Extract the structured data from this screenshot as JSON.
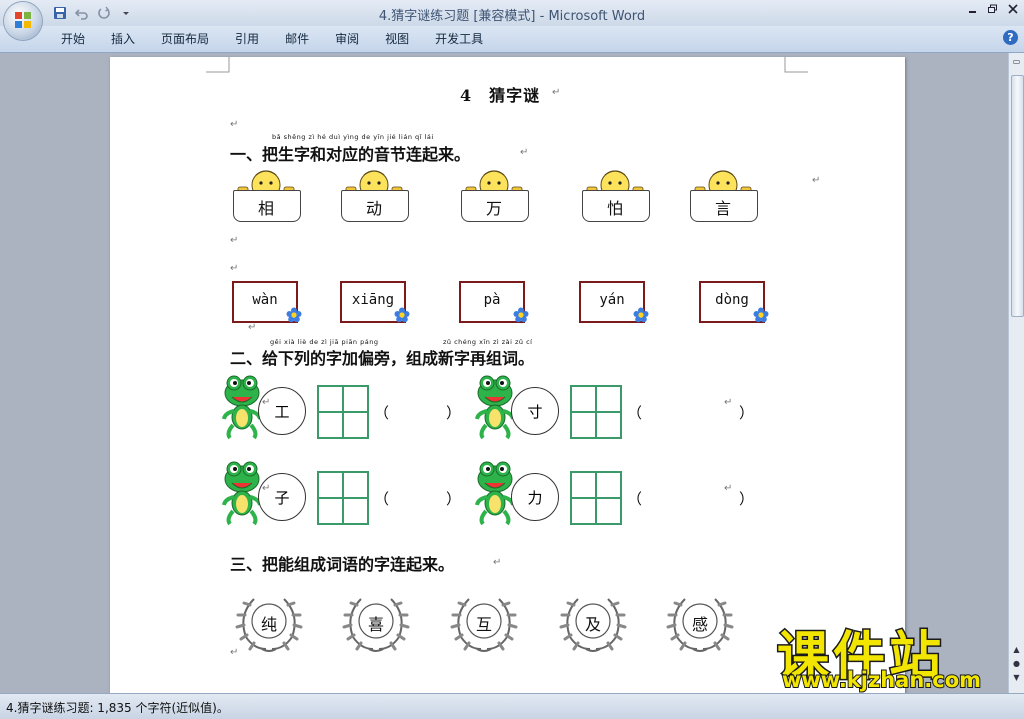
{
  "window": {
    "title": "4.猜字谜练习题 [兼容模式] - Microsoft Word",
    "controls": [
      "minimize-icon",
      "restore-icon",
      "close-icon"
    ]
  },
  "quick_access": [
    "save-icon",
    "undo-icon",
    "redo-icon",
    "customize-icon"
  ],
  "ribbon": {
    "tabs": [
      "开始",
      "插入",
      "页面布局",
      "引用",
      "邮件",
      "审阅",
      "视图",
      "开发工具"
    ],
    "help": "?"
  },
  "document": {
    "title": "4　猜字谜",
    "section1": {
      "pinyin": "bǎ shēng zì hé duì yìng de yīn jié lián qǐ lái",
      "heading": "一、把生字和对应的音节连起来。",
      "characters": [
        "相",
        "动",
        "万",
        "怕",
        "言"
      ],
      "syllables": [
        "wàn",
        "xiāng",
        "pà",
        "yán",
        "dòng"
      ]
    },
    "section2": {
      "pinyin_a": "gěi xià liè de zì jiā piān páng",
      "pinyin_b": "zǔ chéng xīn zì zài zǔ cí",
      "heading": "二、给下列的字加偏旁，组成新字再组词。",
      "characters": [
        "工",
        "寸",
        "子",
        "力"
      ],
      "paren_open": "（",
      "paren_close": "）"
    },
    "section3": {
      "heading": "三、把能组成词语的字连起来。",
      "characters": [
        "纯",
        "喜",
        "互",
        "及",
        "感"
      ]
    },
    "paragraph_mark": "↵"
  },
  "status_bar": {
    "text": "4.猜字谜练习题: 1,835 个字符(近似值)。"
  },
  "watermark": {
    "title": "课件站",
    "url": "www.kjzhan.com"
  },
  "colors": {
    "ribbon": "#c5d5ea",
    "box_border": "#7a1a1a",
    "grid": "#3a9a6a",
    "frog": "#2db34a",
    "watermark": "#f2e600"
  }
}
